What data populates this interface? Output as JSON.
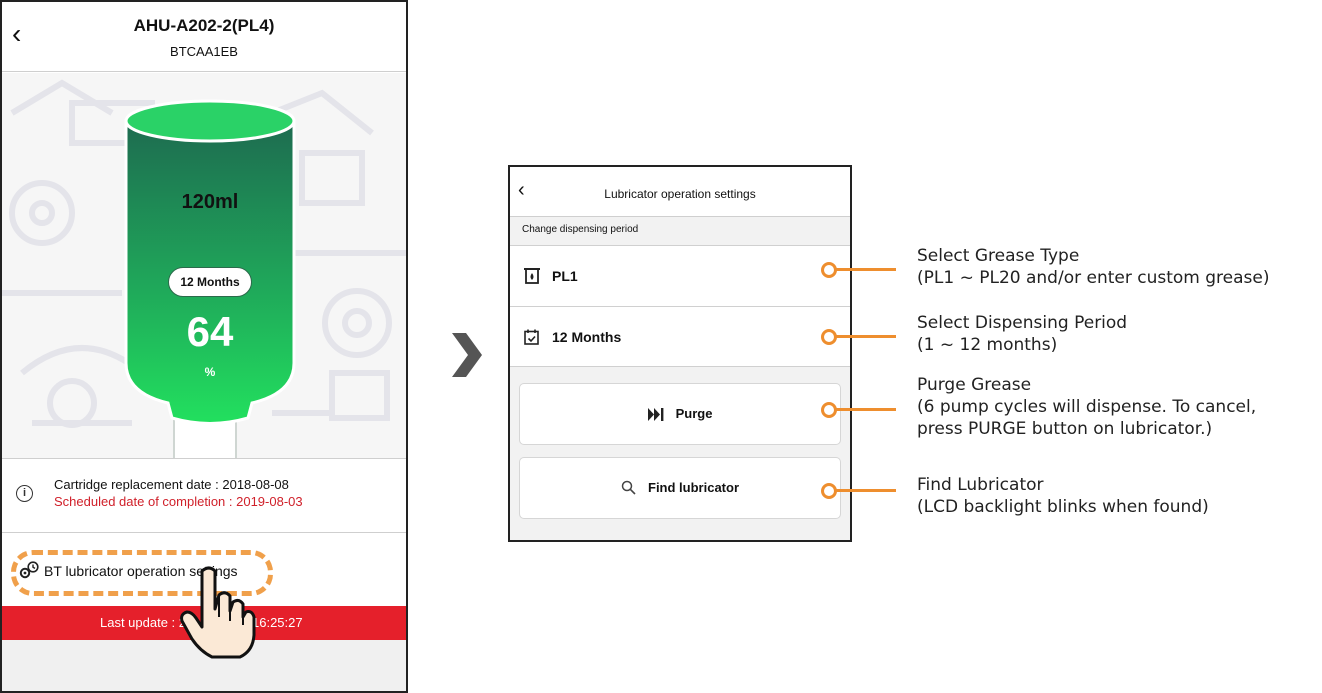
{
  "left_screen": {
    "back_icon": "chevron-left-icon",
    "title": "AHU-A202-2(PL4)",
    "subtitle": "BTCAA1EB",
    "cartridge": {
      "volume": "120ml",
      "period": "12 Months",
      "percent": "64",
      "percent_unit": "%",
      "fill_fraction": 0.64,
      "colors": {
        "top": "#1e6b50",
        "bottom": "#22e05e",
        "cap": "#2ad267"
      }
    },
    "info": {
      "icon": "info-circle-icon",
      "replacement_date": "Cartridge replacement date : 2018-08-08",
      "scheduled_completion": "Scheduled date of completion : 2019-08-03"
    },
    "settings": {
      "icon": "gear-clock-icon",
      "label": "BT lubricator operation settings"
    },
    "update_bar": {
      "label": "Last update : 20",
      "time": "16:25:27",
      "color": "#e5202b"
    },
    "pointer_icon": "hand-pointer-icon"
  },
  "arrow_icon": "chevron-right-icon",
  "right_screen": {
    "back_icon": "chevron-left-icon",
    "title": "Lubricator operation settings",
    "section_label": "Change dispensing period",
    "grease": {
      "icon": "grease-cartridge-icon",
      "label": "PL1"
    },
    "period": {
      "icon": "calendar-check-icon",
      "label": "12 Months"
    },
    "purge_button": {
      "icon": "fast-forward-icon",
      "label": "Purge"
    },
    "find_button": {
      "icon": "search-icon",
      "label": "Find lubricator"
    }
  },
  "callouts": [
    {
      "title": "Select Grease Type",
      "lines": [
        "(PL1 ~ PL20 and/or enter custom grease)"
      ]
    },
    {
      "title": "Select Dispensing Period",
      "lines": [
        "(1 ~ 12 months)"
      ]
    },
    {
      "title": "Purge Grease",
      "lines": [
        "(6 pump cycles will dispense. To cancel,",
        "press PURGE button on lubricator.)"
      ]
    },
    {
      "title": "Find Lubricator",
      "lines": [
        "(LCD backlight blinks when found)"
      ]
    }
  ],
  "accent_color": "#ee8e2e"
}
